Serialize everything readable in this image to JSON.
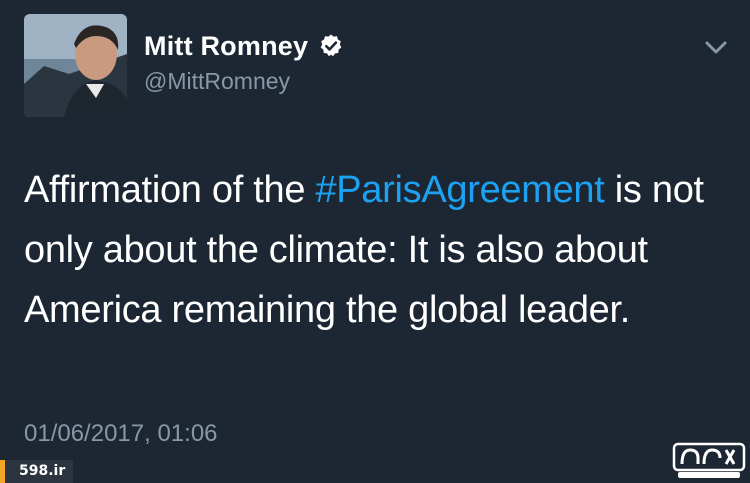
{
  "tweet": {
    "author": {
      "display_name": "Mitt Romney",
      "handle": "@MittRomney",
      "verified": true,
      "verified_icon": "verified-badge-icon",
      "avatar_icon": "profile-photo"
    },
    "menu_icon": "chevron-down-icon",
    "text_segments": {
      "before": "Affirmation of the ",
      "hashtag": "#ParisAgreement",
      "after": " is not only about the climate: It is also about America remaining the global leader."
    },
    "timestamp": "01/06/2017, 01:06"
  },
  "watermarks": {
    "site_label": "598.ir",
    "logo": "598-logo"
  },
  "colors": {
    "background": "#1c2733",
    "text_primary": "#ffffff",
    "text_secondary": "#8899a6",
    "hashtag": "#1da1f2",
    "watermark_accent": "#f5a623"
  }
}
